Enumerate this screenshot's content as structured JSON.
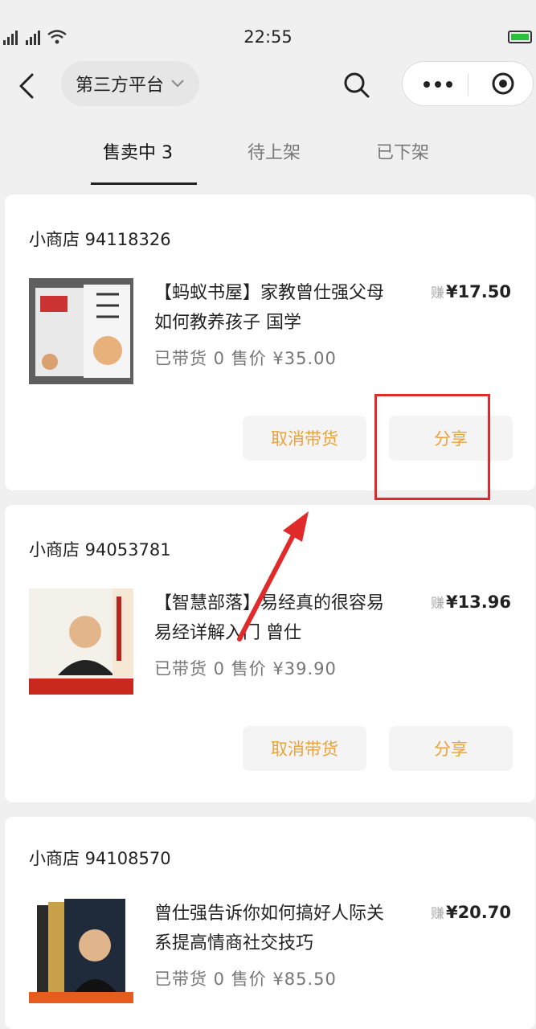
{
  "status_bar": {
    "time": "22:55"
  },
  "nav": {
    "platform_label": "第三方平台"
  },
  "tabs": [
    {
      "label": "售卖中 3"
    },
    {
      "label": "待上架"
    },
    {
      "label": "已下架"
    }
  ],
  "products": [
    {
      "shop": "小商店 94118326",
      "title": "【蚂蚁书屋】家教曾仕强父母如何教养孩子 国学",
      "stats": "已带货 0 售价 ¥35.00",
      "earn_tag": "赚",
      "earn_price": "¥17.50",
      "cancel_label": "取消带货",
      "share_label": "分享"
    },
    {
      "shop": "小商店 94053781",
      "title": "【智慧部落】易经真的很容易 易经详解入门 曾仕",
      "stats": "已带货 0 售价 ¥39.90",
      "earn_tag": "赚",
      "earn_price": "¥13.96",
      "cancel_label": "取消带货",
      "share_label": "分享"
    },
    {
      "shop": "小商店 94108570",
      "title": "曾仕强告诉你如何搞好人际关系提高情商社交技巧",
      "stats": "已带货 0 售价 ¥85.50",
      "earn_tag": "赚",
      "earn_price": "¥20.70"
    }
  ],
  "colors": {
    "accent_orange": "#e8a33b",
    "highlight_red": "#e12b2b",
    "background": "#f0f0f0"
  },
  "icons": [
    "back-arrow-icon",
    "chevron-down-icon",
    "search-icon",
    "more-dots-icon",
    "target-icon",
    "signal-icon",
    "wifi-icon",
    "battery-icon"
  ]
}
